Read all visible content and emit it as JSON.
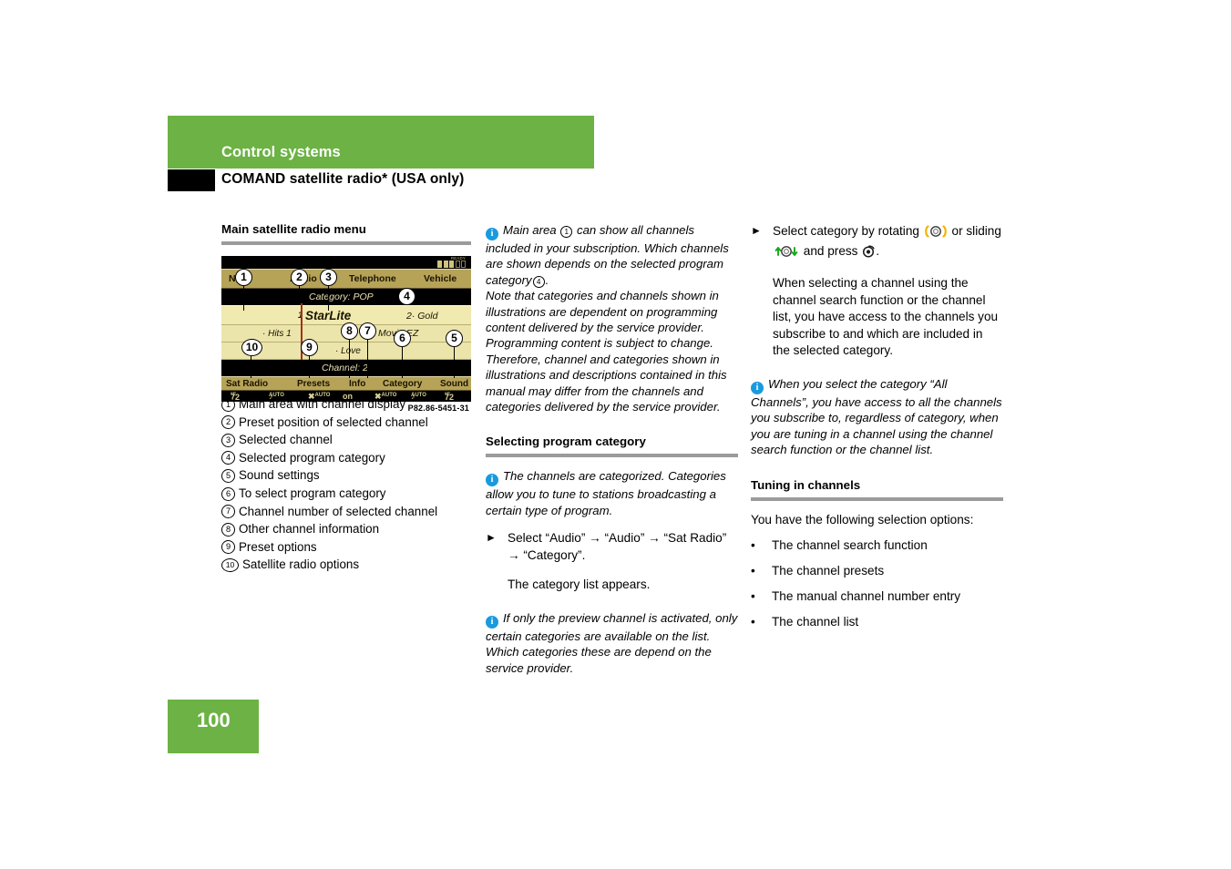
{
  "header": {
    "chapter": "Control systems",
    "section": "COMAND satellite radio* (USA only)"
  },
  "footer": {
    "page_number": "100"
  },
  "colors": {
    "brand_green": "#6cb244",
    "info_blue": "#1a9ade",
    "rule_gray": "#9b9b9b",
    "screen_gold": "#b6a358",
    "screen_cream": "#f0e9b0",
    "pointer_red": "#a33217"
  },
  "left_column": {
    "subheading": "Main satellite radio menu",
    "figure": {
      "caption": "P82.86-5451-31",
      "screen": {
        "status_ready": "READY",
        "menubar": [
          "Navi",
          "Audio",
          "Telephone",
          "Vehicle"
        ],
        "category_line": "Category: POP",
        "selected_preset": "1",
        "selected_channel": "StarLite",
        "row1_right": "2· Gold",
        "row2_left": "· Hits 1",
        "row2_right": "Movin EZ",
        "row3_left": "· Love",
        "channel_line": "Channel: 2",
        "softkeys": [
          "Sat Radio",
          "Presets",
          "Info",
          "Category",
          "Sound"
        ],
        "climate": {
          "left_temp": "72",
          "left_unit": "°F",
          "center_state": "on",
          "right_temp": "72",
          "right_unit": "°F",
          "auto_label": "AUTO"
        }
      },
      "callouts": [
        "1",
        "2",
        "3",
        "4",
        "5",
        "6",
        "7",
        "8",
        "9",
        "10"
      ]
    },
    "legend": [
      {
        "num": "1",
        "text": "Main area with channel display"
      },
      {
        "num": "2",
        "text": "Preset position of selected channel"
      },
      {
        "num": "3",
        "text": "Selected channel"
      },
      {
        "num": "4",
        "text": "Selected program category"
      },
      {
        "num": "5",
        "text": "Sound settings"
      },
      {
        "num": "6",
        "text": "To select program category"
      },
      {
        "num": "7",
        "text": "Channel number of selected channel"
      },
      {
        "num": "8",
        "text": "Other channel information"
      },
      {
        "num": "9",
        "text": "Preset options"
      },
      {
        "num": "10",
        "text": "Satellite radio options"
      }
    ]
  },
  "middle_column": {
    "note1_part1": "Main area",
    "note1_ref1": "1",
    "note1_part2": "can show all channels included in your subscription. Which channels are shown depends on the selected program category",
    "note1_ref2": "4",
    "note1_part3": ".",
    "note1_rest": "Note that categories and channels shown in illustrations are dependent on programming content delivered by the service provider. Programming content is subject to change. Therefore, channel and categories shown in illustrations and descriptions contained in this manual may differ from the channels and categories delivered by the service provider.",
    "subheading": "Selecting program category",
    "note2": "The channels are categorized. Categories allow you to tune to stations broadcasting a certain type of program.",
    "step_text": "Select “Audio” → “Audio” → “Sat Radio” → “Category”.",
    "step_result": "The category list appears.",
    "note3": "If only the preview channel is activated, only certain categories are available on the list. Which categories these are depend on the service provider."
  },
  "right_column": {
    "step_prefix": "Select category by rotating",
    "step_mid": "or sliding",
    "step_suffix": "and press",
    "step_end": ".",
    "paragraph": "When selecting a channel using the channel search function or the channel list, you have access to the channels you subscribe to and which are included in the selected category.",
    "note": "When you select the category “All Channels”, you have access to all the channels you subscribe to, regardless of category, when you are tuning in a channel using the channel search function or the channel list.",
    "subheading": "Tuning in channels",
    "intro": "You have the following selection options:",
    "bullets": [
      "The channel search function",
      "The channel presets",
      "The manual channel number entry",
      "The channel list"
    ]
  }
}
